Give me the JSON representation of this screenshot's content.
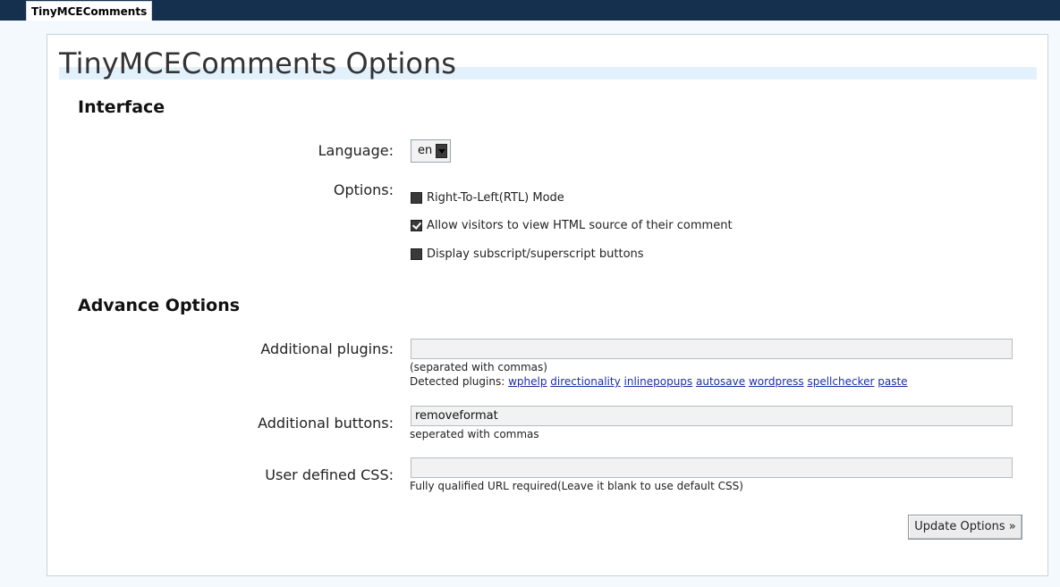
{
  "tab": {
    "label": "TinyMCEComments"
  },
  "page": {
    "title": "TinyMCEComments Options"
  },
  "interface": {
    "heading": "Interface",
    "language": {
      "label": "Language:",
      "value": "en"
    },
    "options": {
      "label": "Options:",
      "items": [
        {
          "label": "Right-To-Left(RTL) Mode",
          "checked": false
        },
        {
          "label": "Allow visitors to view HTML source of their comment",
          "checked": true
        },
        {
          "label": "Display subscript/superscript buttons",
          "checked": false
        }
      ]
    }
  },
  "advance": {
    "heading": "Advance Options",
    "plugins": {
      "label": "Additional plugins:",
      "value": "",
      "hint": "(separated with commas)",
      "detected_prefix": "Detected plugins:",
      "detected": [
        "wphelp",
        "directionality",
        "inlinepopups",
        "autosave",
        "wordpress",
        "spellchecker",
        "paste"
      ]
    },
    "buttons": {
      "label": "Additional buttons:",
      "value": "removeformat",
      "hint": "seperated with commas"
    },
    "css": {
      "label": "User defined CSS:",
      "value": "",
      "hint": "Fully qualified URL required(Leave it blank to use default CSS)"
    }
  },
  "submit": {
    "label": "Update Options »"
  }
}
